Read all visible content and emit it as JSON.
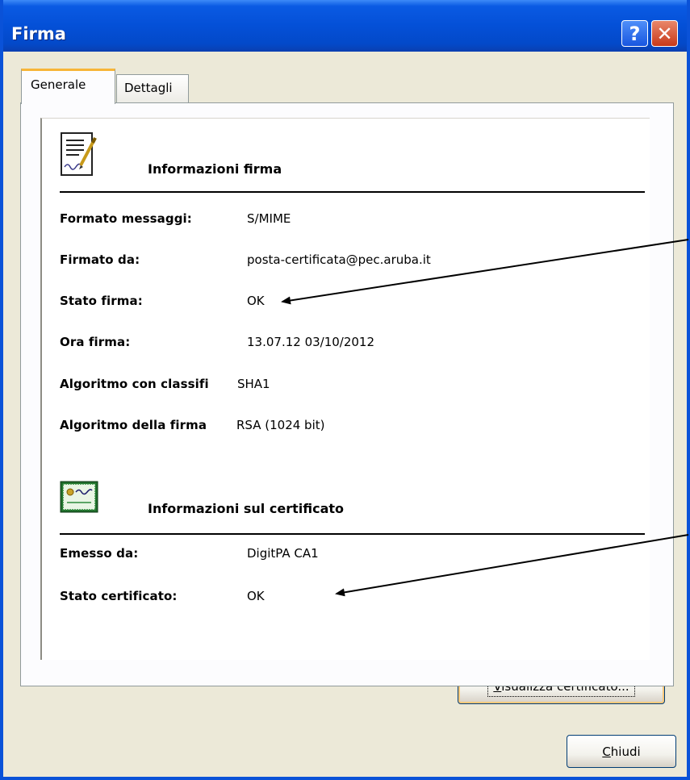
{
  "window": {
    "title": "Firma",
    "help_button": "?",
    "close_button": "✕"
  },
  "tabs": [
    {
      "label": "Generale",
      "active": true
    },
    {
      "label": "Dettagli",
      "active": false
    }
  ],
  "signature_section": {
    "icon": "signed-document-icon",
    "title": "Informazioni firma",
    "rows": [
      {
        "label": "Formato messaggi:",
        "value": "S/MIME"
      },
      {
        "label": "Firmato da:",
        "value": "posta-certificata@pec.aruba.it"
      },
      {
        "label": "Stato firma:",
        "value": "OK"
      },
      {
        "label": "Ora firma:",
        "value": "13.07.12 03/10/2012"
      },
      {
        "label": "Algoritmo con classifi",
        "value": "SHA1"
      },
      {
        "label": "Algoritmo della firma",
        "value": "RSA (1024 bit)"
      }
    ]
  },
  "certificate_section": {
    "icon": "certificate-icon",
    "title": "Informazioni sul certificato",
    "rows": [
      {
        "label": "Emesso da:",
        "value": "DigitPA CA1"
      },
      {
        "label": "Stato certificato:",
        "value": "OK"
      }
    ]
  },
  "buttons": {
    "view_certificate": {
      "accel": "V",
      "rest": "isualizza certificato..."
    },
    "close": {
      "accel": "C",
      "rest": "hiudi"
    }
  },
  "colors": {
    "titlebar": "#0450d7",
    "dialog_bg": "#ece9d8",
    "active_tab_accent": "#f7b538",
    "close_button": "#c7391a"
  }
}
